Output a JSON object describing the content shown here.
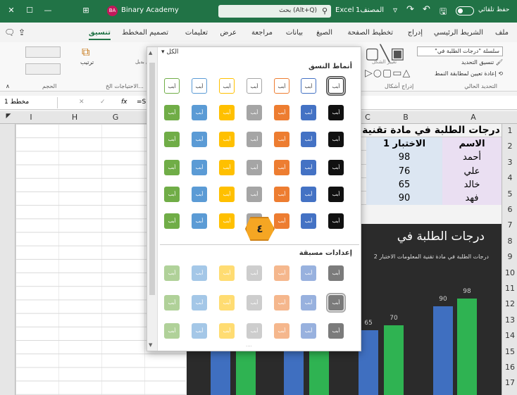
{
  "titlebar": {
    "app": "Excel",
    "workbook": "المصنف1",
    "search": "بحث (Alt+Q)",
    "autosave": "حفظ تلقائي",
    "user": "Binary Academy",
    "user_initials": "BA"
  },
  "tabs": [
    "ملف",
    "الشريط الرئيسي",
    "إدراج",
    "تخطيط الصفحة",
    "الصيغ",
    "بيانات",
    "مراجعة",
    "عرض",
    "تعليمات",
    "تصميم المخطط",
    "تنسيق"
  ],
  "active_tab": "تنسيق",
  "ribbon": {
    "series_select": "سلسلة \"درجات الطلبة في\"",
    "format_selection": "تنسيق التحديد",
    "reset_style": "إعادة تعيين لمطابقة النمط",
    "current_selection": "التحديد الحالي",
    "insert_shapes": "إدراج أشكال",
    "change_shape": "تغيير الشكل",
    "arrange": "ترتيب",
    "size": "الحجم",
    "alt_text": "نص بديل",
    "accessibility": "الاحتياجات الخ..."
  },
  "formula": {
    "namebox": "مخطط 1",
    "fx": "fx",
    "content": "=SE"
  },
  "columns": [
    "I",
    "H",
    "G",
    "C",
    "B",
    "A"
  ],
  "rows": [
    "1",
    "2",
    "3",
    "4",
    "5",
    "6",
    "7",
    "8",
    "9",
    "10",
    "11",
    "12",
    "13",
    "14",
    "15",
    "16",
    "17"
  ],
  "sheet": {
    "title": "درجات الطلبة في مادة تقنية",
    "col_name": "الاسم",
    "col_test": "الاختبار 1",
    "data": [
      {
        "name": "أحمد",
        "score": "98"
      },
      {
        "name": "علي",
        "score": "76"
      },
      {
        "name": "خالد",
        "score": "65"
      },
      {
        "name": "فهد",
        "score": "90"
      }
    ]
  },
  "chart": {
    "title": "درجات الطلبة في",
    "subtitle": "درجات الطلبة في مادة تقنية المعلومات الاختبار 2",
    "labels": [
      "65",
      "70",
      "90",
      "98"
    ]
  },
  "gallery": {
    "all": "الكل",
    "heading": "أنماط النسق",
    "presets": "إعدادات مسبقة",
    "sample": "أبب",
    "colors": [
      "#111111",
      "#4472c4",
      "#ed7d31",
      "#a5a5a5",
      "#ffc000",
      "#5b9bd5",
      "#70ad47"
    ]
  },
  "callout": "٤"
}
